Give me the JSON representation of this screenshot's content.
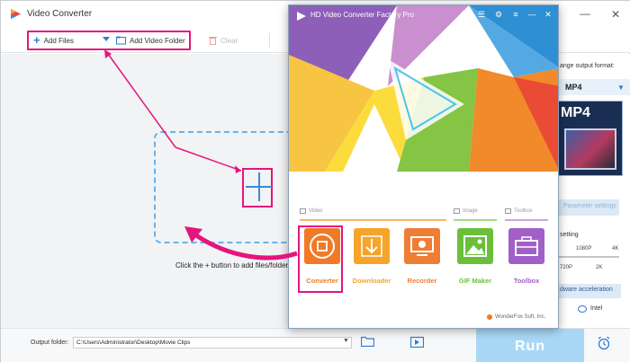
{
  "main_window": {
    "title": "Video Converter",
    "toolbar": {
      "add_files": "Add Files",
      "add_video_folder": "Add Video Folder",
      "clear": "Clear"
    },
    "hint": "Click the + button to add files/folder,o"
  },
  "right_panel": {
    "change_format_label": "ange output format:",
    "format_value": "MP4",
    "thumb_label": "MP4",
    "settings_button": "Parameter settings",
    "setting_label": "setting",
    "quality_ticks_top": [
      "1080P",
      "4K"
    ],
    "quality_ticks_bottom": [
      "720P",
      "2K"
    ],
    "hw_accel": "dware acceleration",
    "hw_brand": "Intel"
  },
  "bottom_bar": {
    "output_folder_label": "Output folder:",
    "output_path": "C:\\Users\\Administrator\\Desktop\\Movie Clips",
    "run_label": "Run"
  },
  "overlay": {
    "title": "HD Video Converter Factory Pro",
    "sections": {
      "video": "Video",
      "image": "Image",
      "toolbox": "Toolbox"
    },
    "tools": [
      {
        "label": "Converter",
        "color": "#f07a28",
        "icon": "film-reel-icon"
      },
      {
        "label": "Downloader",
        "color": "#f4a52a",
        "icon": "download-arrow-icon"
      },
      {
        "label": "Recorder",
        "color": "#ef7d34",
        "icon": "screen-record-icon"
      },
      {
        "label": "GIF Maker",
        "color": "#6bbf3a",
        "icon": "image-landscape-icon"
      },
      {
        "label": "Toolbox",
        "color": "#a15fc8",
        "icon": "toolbox-case-icon"
      }
    ],
    "footer": "WonderFox Soft, Inc."
  },
  "colors": {
    "highlight": "#e5157d",
    "primary_blue": "#2c7cd3",
    "run_button": "#a9d8f7"
  }
}
